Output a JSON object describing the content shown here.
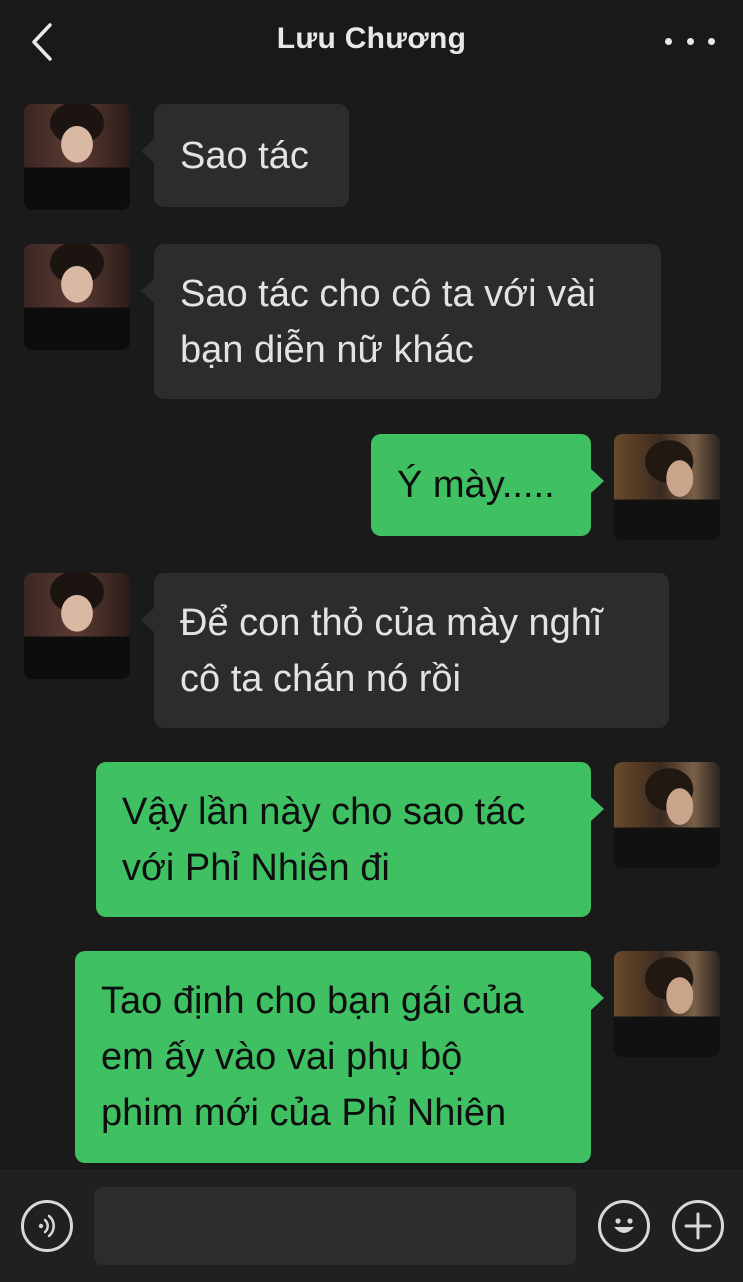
{
  "header": {
    "title": "Lưu Chương"
  },
  "icons": {
    "back": "chevron-left-icon",
    "more": "more-dots-icon",
    "voice": "voice-icon",
    "emoji": "emoji-icon",
    "add": "plus-icon"
  },
  "colors": {
    "sent_bubble": "#3fc163",
    "received_bubble": "#2c2c2c",
    "background": "#1a1a1a"
  },
  "messages": [
    {
      "side": "received",
      "text": "Sao tác"
    },
    {
      "side": "received",
      "text": "Sao tác cho cô ta với vài\nbạn diễn nữ khác"
    },
    {
      "side": "sent",
      "text": "Ý mày....."
    },
    {
      "side": "received",
      "text": "Để con thỏ của mày nghĩ\ncô ta chán nó rồi"
    },
    {
      "side": "sent",
      "text": "Vậy lần này cho sao tác\nvới Phỉ Nhiên đi"
    },
    {
      "side": "sent",
      "text": "Tao định cho bạn gái của\nem ấy vào vai phụ bộ\nphim mới của Phỉ Nhiên"
    }
  ],
  "composer": {
    "value": ""
  }
}
